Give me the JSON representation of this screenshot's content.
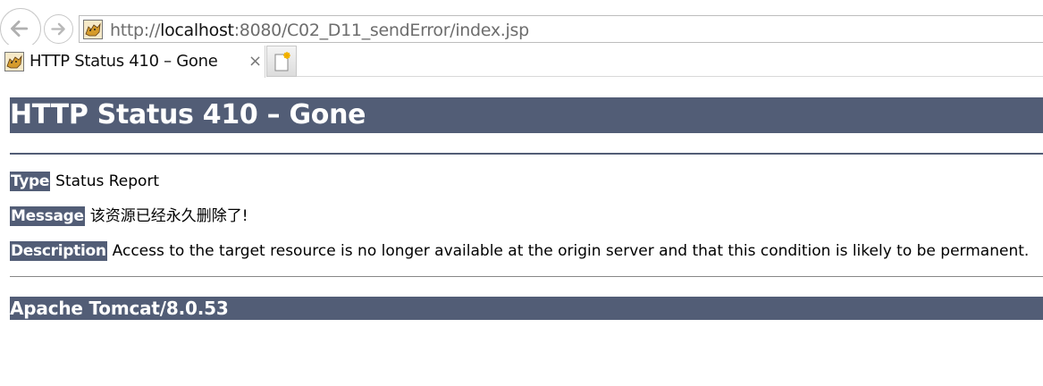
{
  "browser": {
    "url_prefix": "http://",
    "url_host": "localhost",
    "url_rest": ":8080/C02_D11_sendError/index.jsp",
    "tab_title": "HTTP Status 410 – Gone",
    "tab_close": "×",
    "icons": {
      "back": "back-arrow-icon",
      "forward": "forward-arrow-icon",
      "favicon": "tomcat-icon",
      "new_tab": "new-tab-icon"
    }
  },
  "page": {
    "heading": "HTTP Status 410 – Gone",
    "type_label": "Type",
    "type_value": "Status Report",
    "message_label": "Message",
    "message_value": "该资源已经永久删除了!",
    "description_label": "Description",
    "description_value": "Access to the target resource is no longer available at the origin server and that this condition is likely to be permanent.",
    "footer": "Apache Tomcat/8.0.53",
    "accent_color": "#525d76"
  }
}
